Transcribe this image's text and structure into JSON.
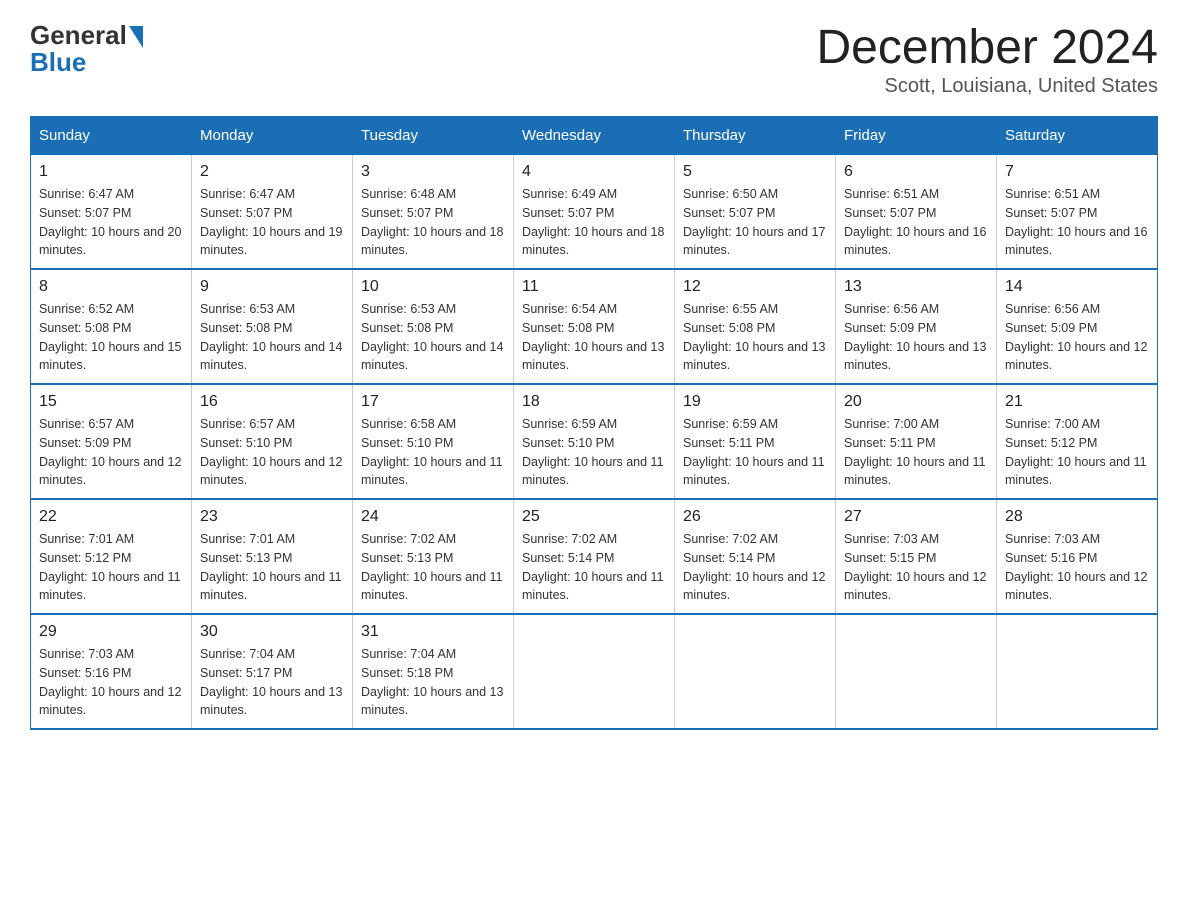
{
  "logo": {
    "general": "General",
    "blue": "Blue"
  },
  "title": "December 2024",
  "subtitle": "Scott, Louisiana, United States",
  "days_of_week": [
    "Sunday",
    "Monday",
    "Tuesday",
    "Wednesday",
    "Thursday",
    "Friday",
    "Saturday"
  ],
  "weeks": [
    [
      {
        "day": "1",
        "sunrise": "6:47 AM",
        "sunset": "5:07 PM",
        "daylight": "10 hours and 20 minutes."
      },
      {
        "day": "2",
        "sunrise": "6:47 AM",
        "sunset": "5:07 PM",
        "daylight": "10 hours and 19 minutes."
      },
      {
        "day": "3",
        "sunrise": "6:48 AM",
        "sunset": "5:07 PM",
        "daylight": "10 hours and 18 minutes."
      },
      {
        "day": "4",
        "sunrise": "6:49 AM",
        "sunset": "5:07 PM",
        "daylight": "10 hours and 18 minutes."
      },
      {
        "day": "5",
        "sunrise": "6:50 AM",
        "sunset": "5:07 PM",
        "daylight": "10 hours and 17 minutes."
      },
      {
        "day": "6",
        "sunrise": "6:51 AM",
        "sunset": "5:07 PM",
        "daylight": "10 hours and 16 minutes."
      },
      {
        "day": "7",
        "sunrise": "6:51 AM",
        "sunset": "5:07 PM",
        "daylight": "10 hours and 16 minutes."
      }
    ],
    [
      {
        "day": "8",
        "sunrise": "6:52 AM",
        "sunset": "5:08 PM",
        "daylight": "10 hours and 15 minutes."
      },
      {
        "day": "9",
        "sunrise": "6:53 AM",
        "sunset": "5:08 PM",
        "daylight": "10 hours and 14 minutes."
      },
      {
        "day": "10",
        "sunrise": "6:53 AM",
        "sunset": "5:08 PM",
        "daylight": "10 hours and 14 minutes."
      },
      {
        "day": "11",
        "sunrise": "6:54 AM",
        "sunset": "5:08 PM",
        "daylight": "10 hours and 13 minutes."
      },
      {
        "day": "12",
        "sunrise": "6:55 AM",
        "sunset": "5:08 PM",
        "daylight": "10 hours and 13 minutes."
      },
      {
        "day": "13",
        "sunrise": "6:56 AM",
        "sunset": "5:09 PM",
        "daylight": "10 hours and 13 minutes."
      },
      {
        "day": "14",
        "sunrise": "6:56 AM",
        "sunset": "5:09 PM",
        "daylight": "10 hours and 12 minutes."
      }
    ],
    [
      {
        "day": "15",
        "sunrise": "6:57 AM",
        "sunset": "5:09 PM",
        "daylight": "10 hours and 12 minutes."
      },
      {
        "day": "16",
        "sunrise": "6:57 AM",
        "sunset": "5:10 PM",
        "daylight": "10 hours and 12 minutes."
      },
      {
        "day": "17",
        "sunrise": "6:58 AM",
        "sunset": "5:10 PM",
        "daylight": "10 hours and 11 minutes."
      },
      {
        "day": "18",
        "sunrise": "6:59 AM",
        "sunset": "5:10 PM",
        "daylight": "10 hours and 11 minutes."
      },
      {
        "day": "19",
        "sunrise": "6:59 AM",
        "sunset": "5:11 PM",
        "daylight": "10 hours and 11 minutes."
      },
      {
        "day": "20",
        "sunrise": "7:00 AM",
        "sunset": "5:11 PM",
        "daylight": "10 hours and 11 minutes."
      },
      {
        "day": "21",
        "sunrise": "7:00 AM",
        "sunset": "5:12 PM",
        "daylight": "10 hours and 11 minutes."
      }
    ],
    [
      {
        "day": "22",
        "sunrise": "7:01 AM",
        "sunset": "5:12 PM",
        "daylight": "10 hours and 11 minutes."
      },
      {
        "day": "23",
        "sunrise": "7:01 AM",
        "sunset": "5:13 PM",
        "daylight": "10 hours and 11 minutes."
      },
      {
        "day": "24",
        "sunrise": "7:02 AM",
        "sunset": "5:13 PM",
        "daylight": "10 hours and 11 minutes."
      },
      {
        "day": "25",
        "sunrise": "7:02 AM",
        "sunset": "5:14 PM",
        "daylight": "10 hours and 11 minutes."
      },
      {
        "day": "26",
        "sunrise": "7:02 AM",
        "sunset": "5:14 PM",
        "daylight": "10 hours and 12 minutes."
      },
      {
        "day": "27",
        "sunrise": "7:03 AM",
        "sunset": "5:15 PM",
        "daylight": "10 hours and 12 minutes."
      },
      {
        "day": "28",
        "sunrise": "7:03 AM",
        "sunset": "5:16 PM",
        "daylight": "10 hours and 12 minutes."
      }
    ],
    [
      {
        "day": "29",
        "sunrise": "7:03 AM",
        "sunset": "5:16 PM",
        "daylight": "10 hours and 12 minutes."
      },
      {
        "day": "30",
        "sunrise": "7:04 AM",
        "sunset": "5:17 PM",
        "daylight": "10 hours and 13 minutes."
      },
      {
        "day": "31",
        "sunrise": "7:04 AM",
        "sunset": "5:18 PM",
        "daylight": "10 hours and 13 minutes."
      },
      null,
      null,
      null,
      null
    ]
  ],
  "labels": {
    "sunrise_prefix": "Sunrise: ",
    "sunset_prefix": "Sunset: ",
    "daylight_prefix": "Daylight: "
  }
}
